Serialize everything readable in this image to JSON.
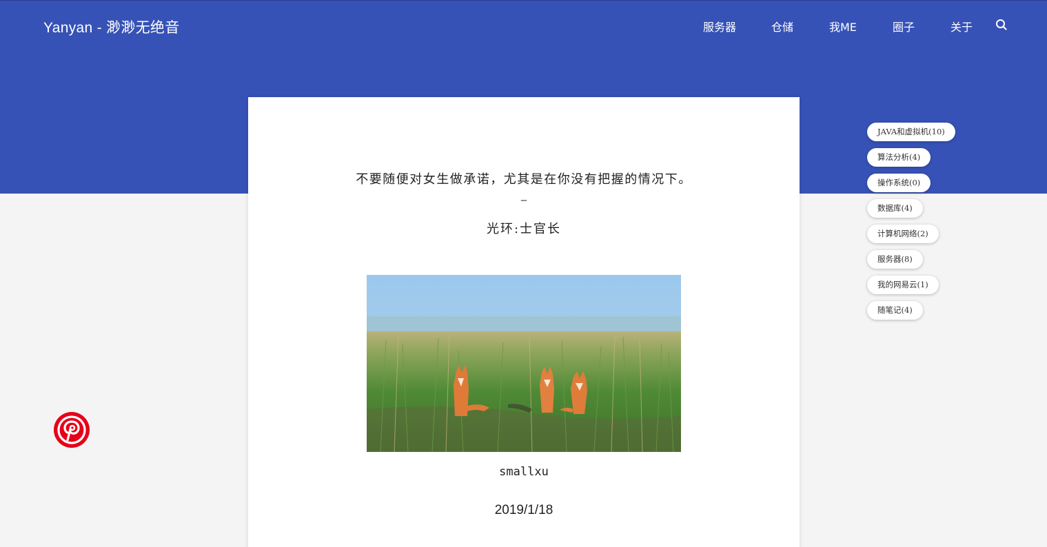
{
  "header": {
    "site_title": "Yanyan - 渺渺无绝音",
    "nav": [
      "服务器",
      "仓储",
      "我ME",
      "圈子",
      "关于"
    ],
    "search_icon": "search-icon",
    "background_color": "#3652b6"
  },
  "post": {
    "quote": "不要随便对女生做承诺，尤其是在你没有把握的情况下。",
    "dash": "–",
    "attribution": "光环:士官长",
    "image_subject": "three foxes sitting in tall green grass",
    "author": "smallxu",
    "date": "2019/1/18"
  },
  "tags": [
    "JAVA和虚拟机(10)",
    "算法分析(4)",
    "操作系统(0)",
    "数据库(4)",
    "计算机网络(2)",
    "服务器(8)",
    "我的网易云(1)",
    "随笔记(4)"
  ],
  "floating_button": {
    "icon": "pinterest-icon",
    "color": "#e60019"
  }
}
